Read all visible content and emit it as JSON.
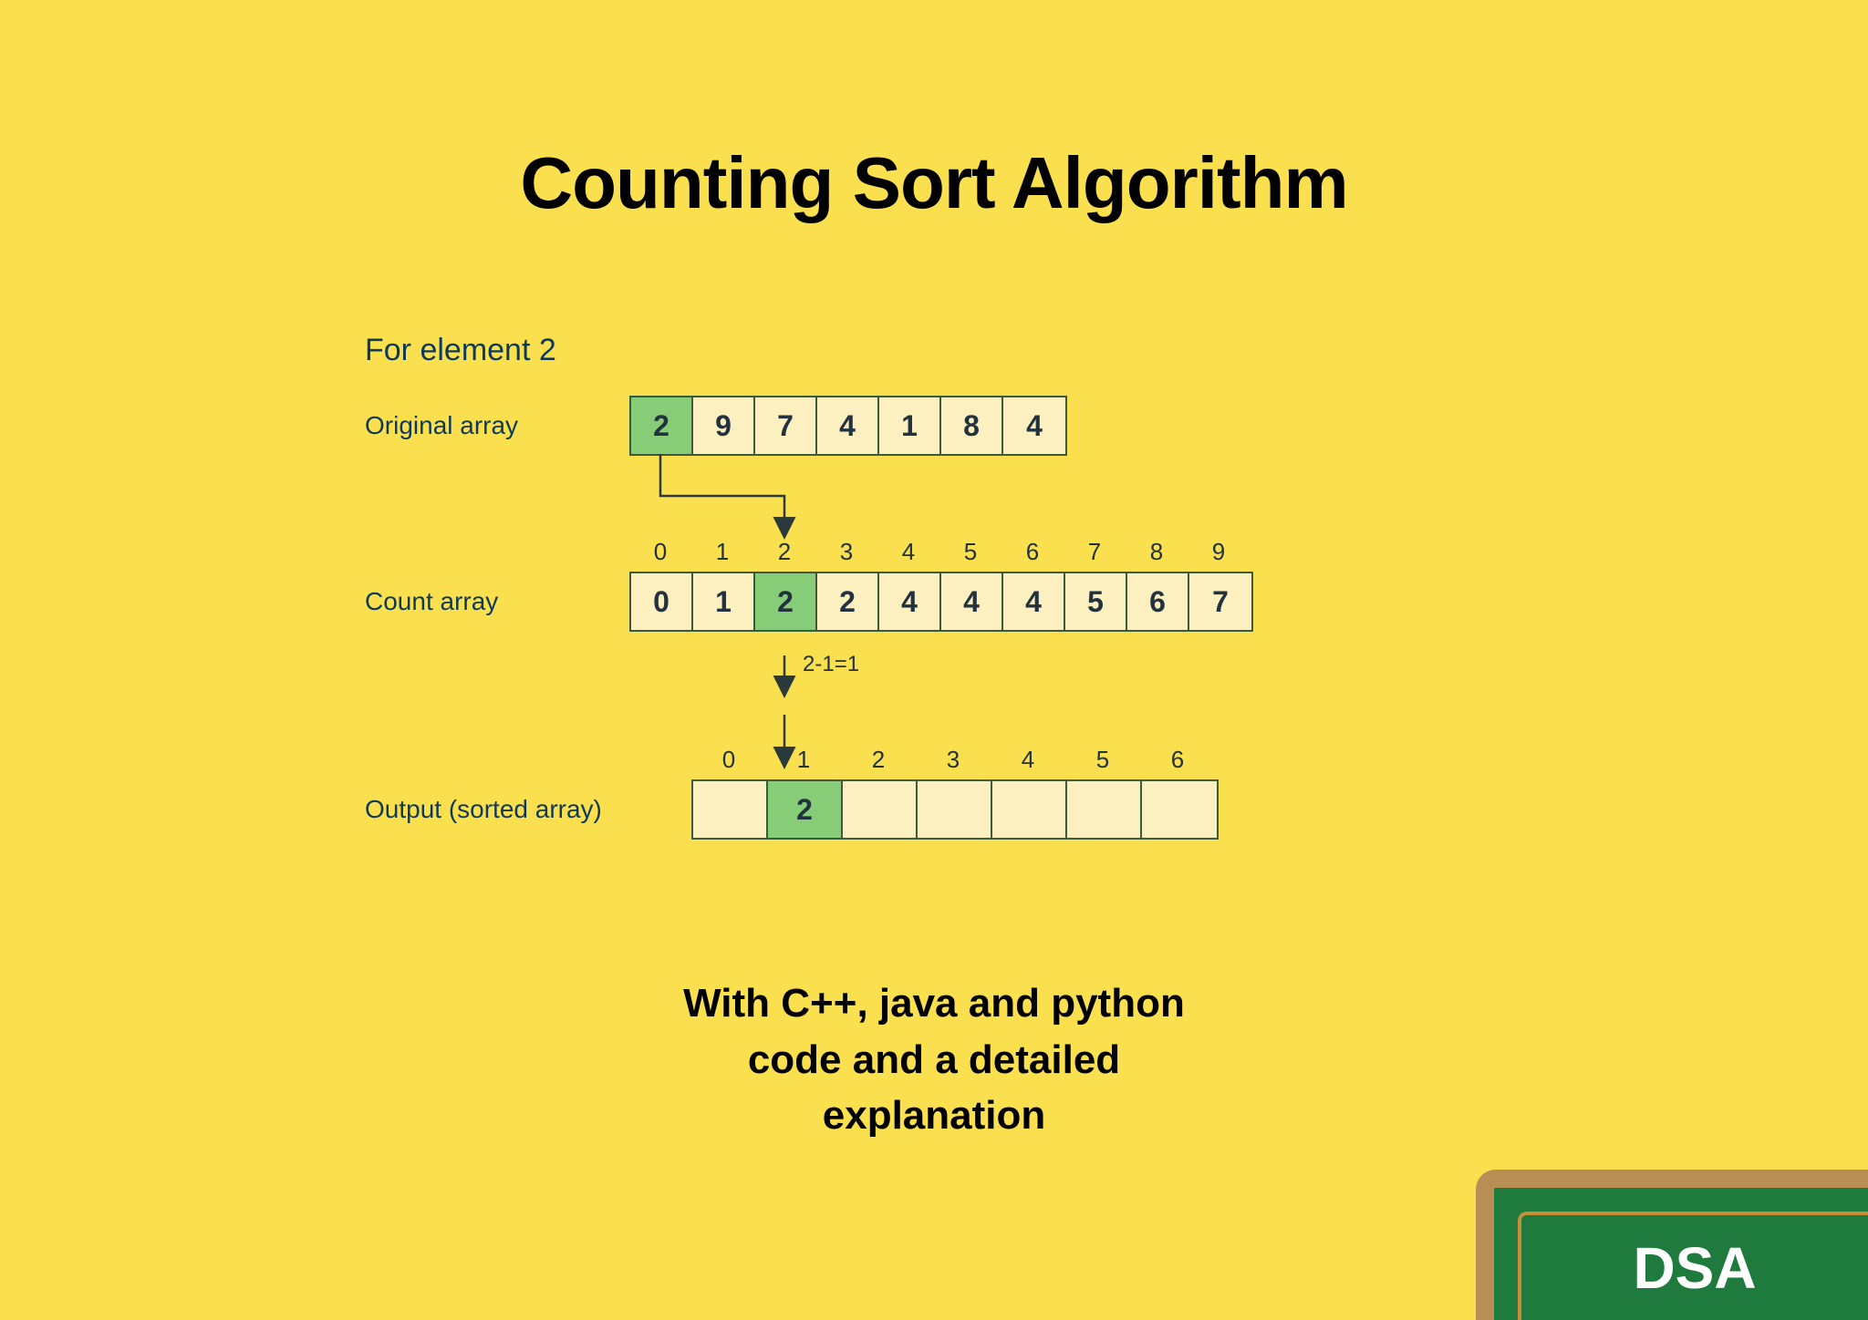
{
  "title": "Counting Sort Algorithm",
  "subtitle_line1": "With C++, java and python",
  "subtitle_line2": "code and a detailed",
  "subtitle_line3": "explanation",
  "step_label": "For element 2",
  "rows": {
    "original": {
      "label": "Original array",
      "cells": [
        "2",
        "9",
        "7",
        "4",
        "1",
        "8",
        "4"
      ],
      "highlight_index": 0
    },
    "count": {
      "label": "Count array",
      "indices": [
        "0",
        "1",
        "2",
        "3",
        "4",
        "5",
        "6",
        "7",
        "8",
        "9"
      ],
      "cells": [
        "0",
        "1",
        "2",
        "2",
        "4",
        "4",
        "4",
        "5",
        "6",
        "7"
      ],
      "highlight_index": 2
    },
    "output": {
      "label": "Output (sorted array)",
      "indices": [
        "0",
        "1",
        "2",
        "3",
        "4",
        "5",
        "6"
      ],
      "cells": [
        "",
        "2",
        "",
        "",
        "",
        "",
        ""
      ],
      "highlight_index": 1
    }
  },
  "annotation": "2-1=1",
  "badge": "DSA"
}
